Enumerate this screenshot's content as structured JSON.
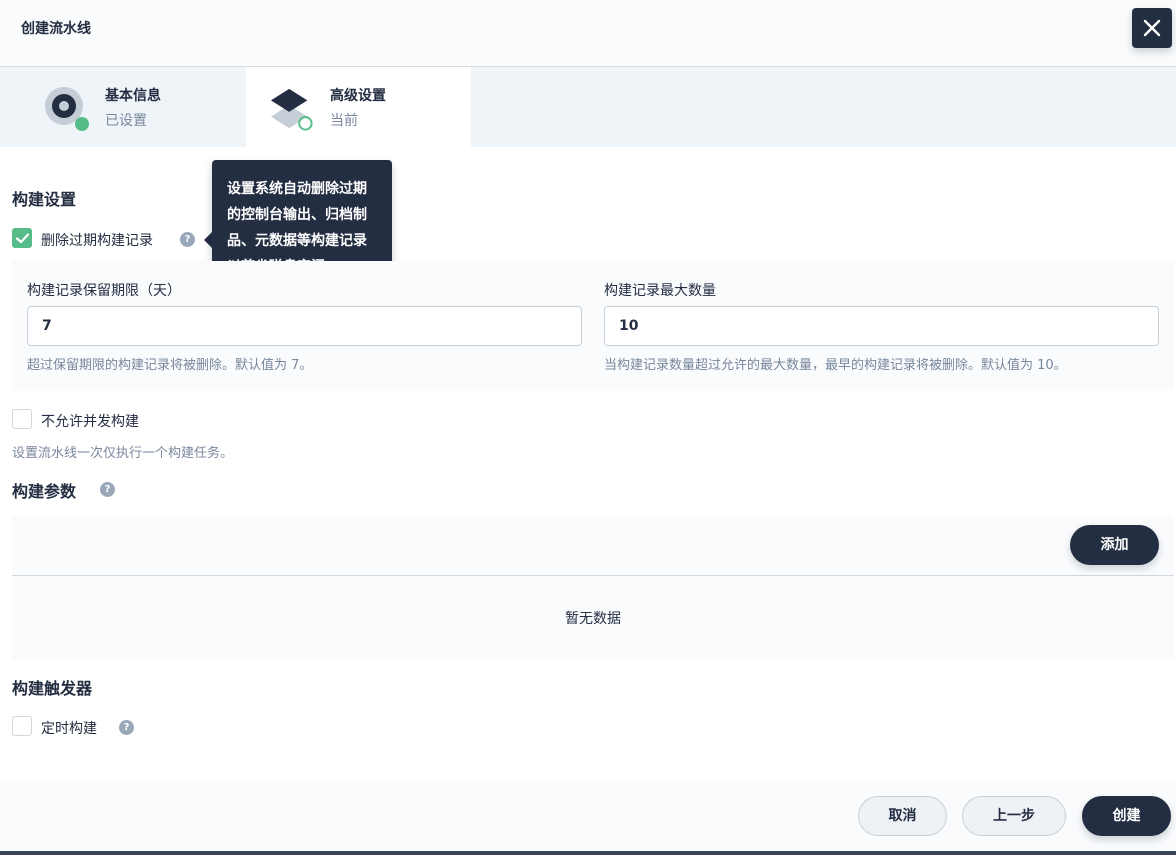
{
  "modal": {
    "title": "创建流水线",
    "close_icon": "close-icon"
  },
  "steps": [
    {
      "title": "基本信息",
      "status": "已设置",
      "icon": "target-icon",
      "indicator_color": "#55bc8a"
    },
    {
      "title": "高级设置",
      "status": "当前",
      "icon": "layers-icon",
      "indicator_color": "#55bc8a"
    }
  ],
  "build_settings": {
    "title": "构建设置",
    "delete_expired": {
      "label": "删除过期构建记录",
      "checked": true
    },
    "tooltip": "设置系统自动删除过期的控制台输出、归档制品、元数据等构建记录以节省磁盘空间。",
    "retention_days": {
      "label": "构建记录保留期限（天）",
      "value": "7",
      "hint": "超过保留期限的构建记录将被删除。默认值为 7。"
    },
    "max_records": {
      "label": "构建记录最大数量",
      "value": "10",
      "hint": "当构建记录数量超过允许的最大数量，最早的构建记录将被删除。默认值为 10。"
    },
    "no_concurrent": {
      "label": "不允许并发构建",
      "checked": false
    },
    "no_concurrent_hint": "设置流水线一次仅执行一个构建任务。"
  },
  "build_params": {
    "title": "构建参数",
    "add_label": "添加",
    "empty_text": "暂无数据"
  },
  "build_triggers": {
    "title": "构建触发器",
    "scheduled": {
      "label": "定时构建",
      "checked": false
    }
  },
  "footer": {
    "cancel_label": "取消",
    "prev_label": "上一步",
    "create_label": "创建"
  },
  "help_icon_text": "?",
  "colors": {
    "primary": "#242e42",
    "success": "#55bc8a",
    "muted": "#79879c"
  }
}
